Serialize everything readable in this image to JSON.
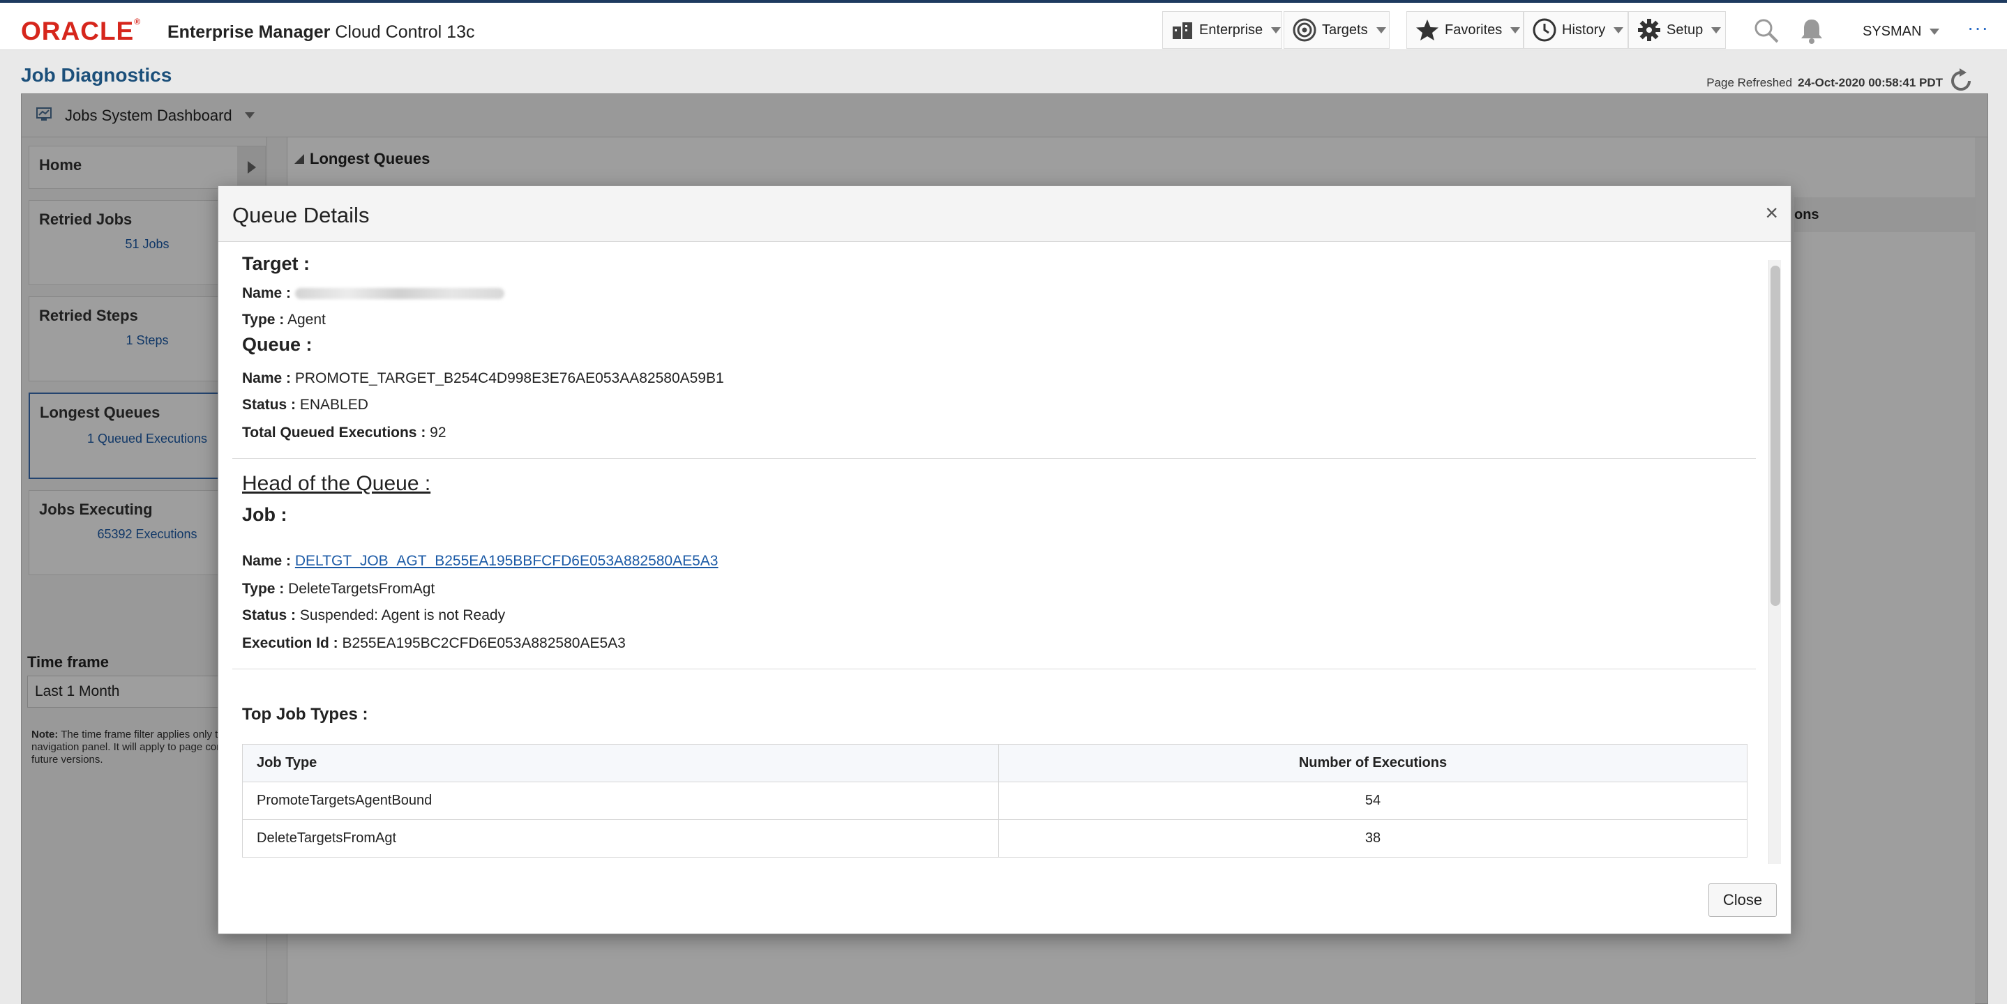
{
  "header": {
    "logo": "ORACLE",
    "product_bold": "Enterprise Manager",
    "product_rest": "Cloud Control 13c",
    "menus": {
      "enterprise": "Enterprise",
      "targets": "Targets",
      "favorites": "Favorites",
      "history": "History",
      "setup": "Setup"
    },
    "user": "SYSMAN"
  },
  "page": {
    "title": "Job Diagnostics",
    "refresh_label": "Page Refreshed",
    "refresh_time": "24-Oct-2020 00:58:41 PDT"
  },
  "dashboard": {
    "label": "Jobs System Dashboard"
  },
  "nav": {
    "home": "Home",
    "cards": [
      {
        "title": "Retried Jobs",
        "value": "51 Jobs"
      },
      {
        "title": "Retried Steps",
        "value": "1 Steps"
      },
      {
        "title": "Longest Queues",
        "value": "1 Queued Executions"
      },
      {
        "title": "Jobs Executing",
        "value": "65392 Executions"
      }
    ],
    "timeframe_label": "Time frame",
    "timeframe_value": "Last 1 Month",
    "note_label": "Note:",
    "note_text": "The time frame filter applies only to the navigation panel. It will apply to page content in future versions."
  },
  "main": {
    "panel_title": "Longest Queues",
    "col_fragment": "ons"
  },
  "modal": {
    "title": "Queue Details",
    "target_heading": "Target :",
    "name_label": "Name :",
    "type_label": "Type :",
    "target_type": "Agent",
    "queue_heading": "Queue :",
    "queue_name": "PROMOTE_TARGET_B254C4D998E3E76AE053AA82580A59B1",
    "status_label": "Status :",
    "queue_status": "ENABLED",
    "total_label": "Total Queued Executions :",
    "total_value": "92",
    "head_heading": "Head of the Queue :",
    "job_heading": "Job :",
    "job_name": "DELTGT_JOB_AGT_B255EA195BBFCFD6E053A882580AE5A3",
    "job_type": "DeleteTargetsFromAgt",
    "job_status": "Suspended: Agent is not Ready",
    "exec_label": "Execution Id :",
    "exec_id": "B255EA195BC2CFD6E053A882580AE5A3",
    "top_types_heading": "Top Job Types :",
    "table": {
      "headers": [
        "Job Type",
        "Number of Executions"
      ],
      "rows": [
        [
          "PromoteTargetsAgentBound",
          "54"
        ],
        [
          "DeleteTargetsFromAgt",
          "38"
        ]
      ]
    },
    "close_label": "Close"
  },
  "colors": {
    "oracle_red": "#d6261c",
    "title_blue": "#1b4f7a",
    "link_blue": "#1b5aa6"
  }
}
